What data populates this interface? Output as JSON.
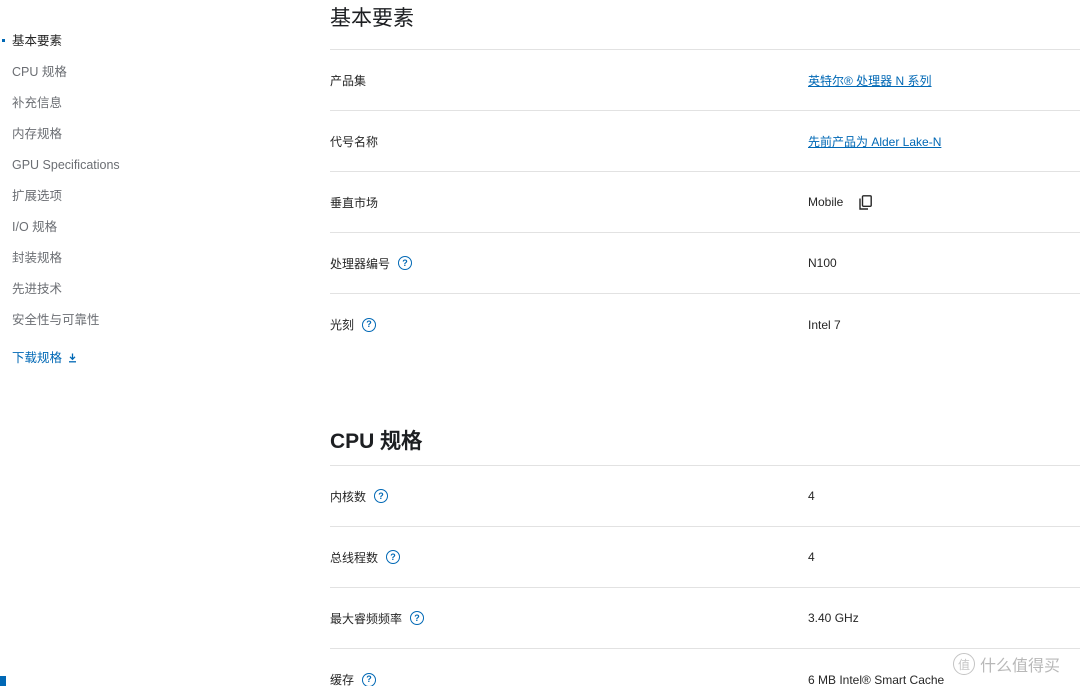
{
  "sidebar": {
    "items": [
      {
        "label": "基本要素",
        "active": true
      },
      {
        "label": "CPU 规格"
      },
      {
        "label": "补充信息"
      },
      {
        "label": "内存规格"
      },
      {
        "label": "GPU Specifications"
      },
      {
        "label": "扩展选项"
      },
      {
        "label": "I/O 规格"
      },
      {
        "label": "封装规格"
      },
      {
        "label": "先进技术"
      },
      {
        "label": "安全性与可靠性"
      }
    ],
    "download_label": "下载规格"
  },
  "sections": {
    "essentials": {
      "title": "基本要素",
      "rows": [
        {
          "label": "产品集",
          "value": "英特尔® 处理器 N 系列",
          "link": true
        },
        {
          "label": "代号名称",
          "value": "先前产品为 Alder Lake-N",
          "link": true
        },
        {
          "label": "垂直市场",
          "value": "Mobile",
          "copy": true
        },
        {
          "label": "处理器编号",
          "value": "N100",
          "help": true
        },
        {
          "label": "光刻",
          "value": "Intel 7",
          "help": true
        }
      ]
    },
    "cpu": {
      "title": "CPU 规格",
      "rows": [
        {
          "label": "内核数",
          "value": "4",
          "help": true
        },
        {
          "label": "总线程数",
          "value": "4",
          "help": true
        },
        {
          "label": "最大睿频频率",
          "value": "3.40 GHz",
          "help": true
        },
        {
          "label": "缓存",
          "value": "6 MB Intel® Smart Cache",
          "help": true
        }
      ]
    }
  },
  "help_glyph": "?",
  "watermark": {
    "logo_glyph": "值",
    "text": "什么值得买"
  },
  "colors": {
    "accent": "#0068b5",
    "text": "#262626",
    "muted": "#6b6e73",
    "divider": "#e2e2e2"
  }
}
